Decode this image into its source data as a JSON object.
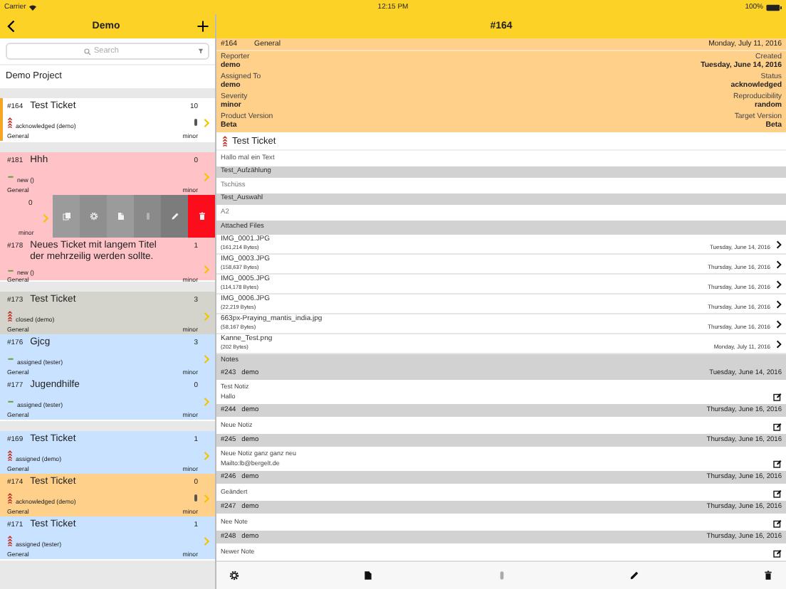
{
  "status_bar": {
    "carrier": "Carrier",
    "time": "12:15 PM",
    "battery": "100%"
  },
  "list_nav": {
    "title": "Demo"
  },
  "search": {
    "placeholder": "Search"
  },
  "project": "Demo Project",
  "ticket_groups": [
    {
      "tickets": [
        {
          "kind": "ticket",
          "id": "#164",
          "title": "Test Ticket",
          "count": "10",
          "high_priority": true,
          "status": "acknowledged (demo)",
          "category": "General",
          "severity": "minor",
          "attachment": true,
          "selected": true,
          "color": "#ffffff"
        }
      ]
    },
    {
      "tickets": [
        {
          "kind": "ticket",
          "id": "#181",
          "title": "Hhh",
          "count": "0",
          "high_priority": false,
          "status": "new ()",
          "category": "General",
          "severity": "minor",
          "attachment": false,
          "selected": false,
          "color": "#ffc2c6"
        },
        {
          "kind": "swiped",
          "count": "0",
          "severity": "minor",
          "color": "#ffc2c6",
          "actions": [
            {
              "kind": "copy",
              "color": "#9b9b9b"
            },
            {
              "kind": "settings",
              "color": "#8f8f8f"
            },
            {
              "kind": "document",
              "color": "#9b9b9b"
            },
            {
              "kind": "attachment",
              "color": "#8a8a8a"
            },
            {
              "kind": "edit",
              "color": "#7c7c7c"
            },
            {
              "kind": "delete",
              "color": "#fc0d1b"
            }
          ]
        },
        {
          "kind": "ticket",
          "id": "#178",
          "title": "Neues Ticket mit langem Titel der mehrzeilig werden sollte.",
          "count": "1",
          "high_priority": false,
          "status": "new ()",
          "category": "General",
          "severity": "minor",
          "attachment": false,
          "selected": false,
          "color": "#ffc2c6"
        }
      ]
    },
    {
      "tickets": [
        {
          "kind": "ticket",
          "id": "#173",
          "title": "Test Ticket",
          "count": "3",
          "high_priority": true,
          "status": "closed (demo)",
          "category": "General",
          "severity": "minor",
          "attachment": false,
          "selected": false,
          "color": "#d4d4cc"
        },
        {
          "kind": "ticket",
          "id": "#176",
          "title": "Gjcg",
          "count": "3",
          "high_priority": false,
          "status": "assigned (tester)",
          "category": "General",
          "severity": "minor",
          "attachment": false,
          "selected": false,
          "color": "#c8e2ff"
        },
        {
          "kind": "ticket",
          "id": "#177",
          "title": "Jugendhilfe",
          "count": "0",
          "high_priority": false,
          "status": "assigned (tester)",
          "category": "General",
          "severity": "minor",
          "attachment": false,
          "selected": false,
          "color": "#c8e2ff"
        }
      ]
    },
    {
      "tickets": [
        {
          "kind": "ticket",
          "id": "#169",
          "title": "Test Ticket",
          "count": "1",
          "high_priority": true,
          "status": "assigned (demo)",
          "category": "General",
          "severity": "minor",
          "attachment": false,
          "selected": false,
          "color": "#c8e2ff"
        },
        {
          "kind": "ticket",
          "id": "#174",
          "title": "Test Ticket",
          "count": "0",
          "high_priority": true,
          "status": "acknowledged (demo)",
          "category": "General",
          "severity": "minor",
          "attachment": true,
          "selected": false,
          "color": "#ffd08a"
        },
        {
          "kind": "ticket",
          "id": "#171",
          "title": "Test Ticket",
          "count": "1",
          "high_priority": true,
          "status": "assigned (tester)",
          "category": "General",
          "severity": "minor",
          "attachment": false,
          "selected": false,
          "color": "#c8e2ff"
        }
      ]
    }
  ],
  "detail": {
    "nav_title": "#164",
    "id": "#164",
    "category": "General",
    "updated": "Monday, July 11, 2016",
    "fields": [
      {
        "left_label": "Reporter",
        "left_value": "demo",
        "right_label": "Created",
        "right_value": "Tuesday, June 14, 2016"
      },
      {
        "left_label": "Assigned To",
        "left_value": "demo",
        "right_label": "Status",
        "right_value": "acknowledged"
      },
      {
        "left_label": "Severity",
        "left_value": "minor",
        "right_label": "Reproducibility",
        "right_value": "random"
      },
      {
        "left_label": "Product Version",
        "left_value": "Beta",
        "right_label": "Target Version",
        "right_value": "Beta"
      }
    ],
    "summary": {
      "high_priority": true,
      "title": "Test Ticket"
    },
    "description": "Hallo mal ein Text",
    "custom_fields": [
      {
        "label": "Test_Aufzählung",
        "value": "Tschüss"
      },
      {
        "label": "Test_Auswahl",
        "value": "A2"
      }
    ],
    "files_header": "Attached Files",
    "files": [
      {
        "name": "IMG_0001.JPG",
        "size": "(161,214 Bytes)",
        "date": "Tuesday, June 14, 2016"
      },
      {
        "name": "IMG_0003.JPG",
        "size": "(158,637 Bytes)",
        "date": "Thursday, June 16, 2016"
      },
      {
        "name": "IMG_0005.JPG",
        "size": "(114,178 Bytes)",
        "date": "Thursday, June 16, 2016"
      },
      {
        "name": "IMG_0006.JPG",
        "size": "(22,219 Bytes)",
        "date": "Thursday, June 16, 2016"
      },
      {
        "name": "663px-Praying_mantis_india.jpg",
        "size": "(58,167 Bytes)",
        "date": "Thursday, June 16, 2016"
      },
      {
        "name": "Kanne_Test.png",
        "size": "(202 Bytes)",
        "date": "Monday, July 11, 2016"
      }
    ],
    "notes_header": "Notes",
    "notes": [
      {
        "id": "#243",
        "author": "demo",
        "date": "Tuesday, June 14, 2016",
        "text": "Test Notiz\nHallo"
      },
      {
        "id": "#244",
        "author": "demo",
        "date": "Thursday, June 16, 2016",
        "text": "Neue Notiz"
      },
      {
        "id": "#245",
        "author": "demo",
        "date": "Thursday, June 16, 2016",
        "text": "Neue Notiz ganz ganz neu\nMailto:lb@bergelt.de"
      },
      {
        "id": "#246",
        "author": "demo",
        "date": "Thursday, June 16, 2016",
        "text": "Geändert"
      },
      {
        "id": "#247",
        "author": "demo",
        "date": "Thursday, June 16, 2016",
        "text": "Nee Note"
      },
      {
        "id": "#248",
        "author": "demo",
        "date": "Thursday, June 16, 2016",
        "text": "Newer Note"
      }
    ]
  },
  "toolbar": [
    {
      "kind": "settings",
      "disabled": false
    },
    {
      "kind": "document",
      "disabled": false
    },
    {
      "kind": "attachment",
      "disabled": true
    },
    {
      "kind": "edit",
      "disabled": false
    },
    {
      "kind": "delete",
      "disabled": false
    }
  ]
}
